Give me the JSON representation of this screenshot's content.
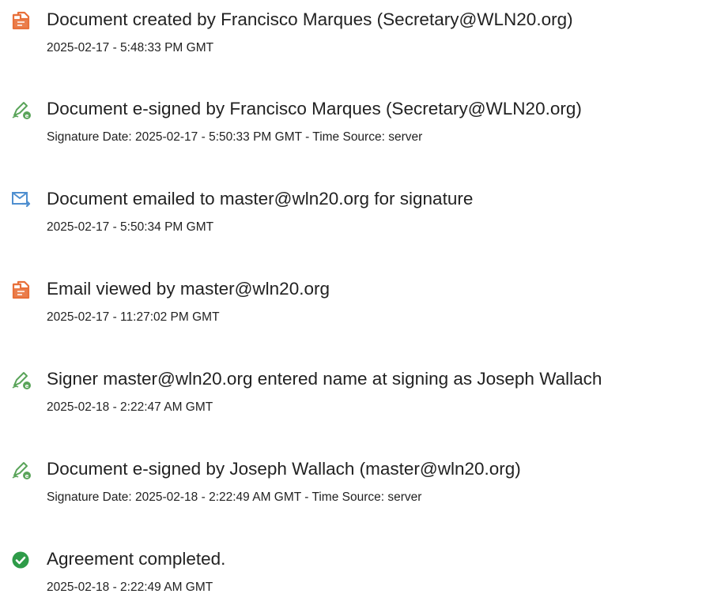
{
  "events": [
    {
      "icon": "document-created-icon",
      "title": "Document created by Francisco Marques (Secretary@WLN20.org)",
      "meta": "2025-02-17 - 5:48:33 PM GMT"
    },
    {
      "icon": "e-sign-pen-icon",
      "title": "Document e-signed by Francisco Marques (Secretary@WLN20.org)",
      "meta": "Signature Date: 2025-02-17 - 5:50:33 PM GMT - Time Source: server"
    },
    {
      "icon": "email-sent-icon",
      "title": "Document emailed to master@wln20.org for signature",
      "meta": "2025-02-17 - 5:50:34 PM GMT"
    },
    {
      "icon": "document-viewed-icon",
      "title": "Email viewed by master@wln20.org",
      "meta": "2025-02-17 - 11:27:02 PM GMT"
    },
    {
      "icon": "e-sign-pen-icon",
      "title": "Signer master@wln20.org entered name at signing as Joseph Wallach",
      "meta": "2025-02-18 - 2:22:47 AM GMT"
    },
    {
      "icon": "e-sign-pen-icon",
      "title": "Document e-signed by Joseph Wallach (master@wln20.org)",
      "meta": "Signature Date: 2025-02-18 - 2:22:49 AM GMT - Time Source: server"
    },
    {
      "icon": "checkmark-circle-icon",
      "title": "Agreement completed.",
      "meta": "2025-02-18 - 2:22:49 AM GMT"
    }
  ],
  "colors": {
    "document_orange": "#e8703a",
    "pen_green": "#5aa45a",
    "email_blue": "#4f8fd0",
    "check_green": "#2e9b48"
  }
}
